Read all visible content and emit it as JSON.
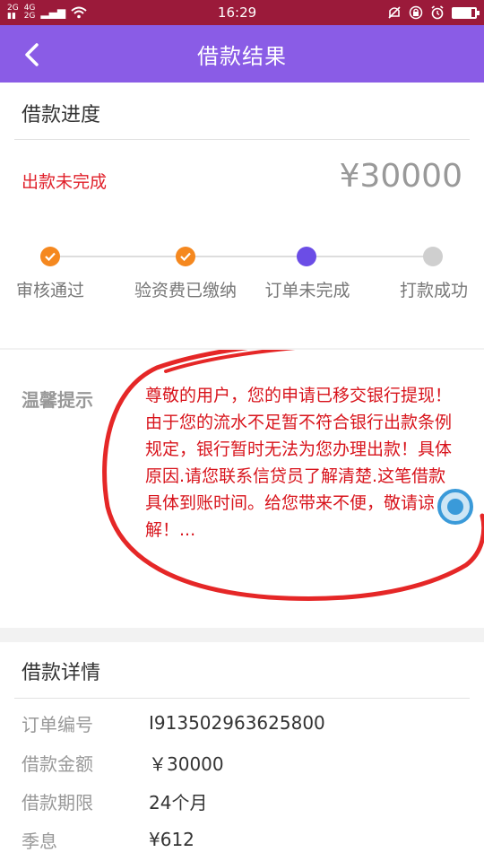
{
  "status_bar": {
    "net1": "2G",
    "net2": "4G",
    "net3": "2G",
    "time": "16:29"
  },
  "app_bar": {
    "title": "借款结果"
  },
  "progress": {
    "section_title": "借款进度",
    "status_text": "出款未完成",
    "amount": "¥30000",
    "steps": [
      {
        "label": "审核通过",
        "state": "done"
      },
      {
        "label": "验资费已缴纳",
        "state": "done"
      },
      {
        "label": "订单未完成",
        "state": "current"
      },
      {
        "label": "打款成功",
        "state": "todo"
      }
    ]
  },
  "tip": {
    "label": "温馨提示",
    "text": "尊敬的用户，您的申请已移交银行提现！由于您的流水不足暂不符合银行出款条例规定，银行暂时无法为您办理出款！具体原因.请您联系信贷员了解清楚.这笔借款具体到账时间。给您带来不便，敬请谅解！..."
  },
  "details": {
    "section_title": "借款详情",
    "rows": [
      {
        "key": "订单编号",
        "value": "I913502963625800"
      },
      {
        "key": "借款金额",
        "value": "￥30000"
      },
      {
        "key": "借款期限",
        "value": "24个月"
      },
      {
        "key": "季息",
        "value": "¥612"
      }
    ]
  },
  "colors": {
    "accent": "#8a5ce6",
    "status_bar": "#9b1a3a",
    "alert_red": "#e0202a",
    "step_done": "#f5881f",
    "step_current": "#6b4de6"
  }
}
